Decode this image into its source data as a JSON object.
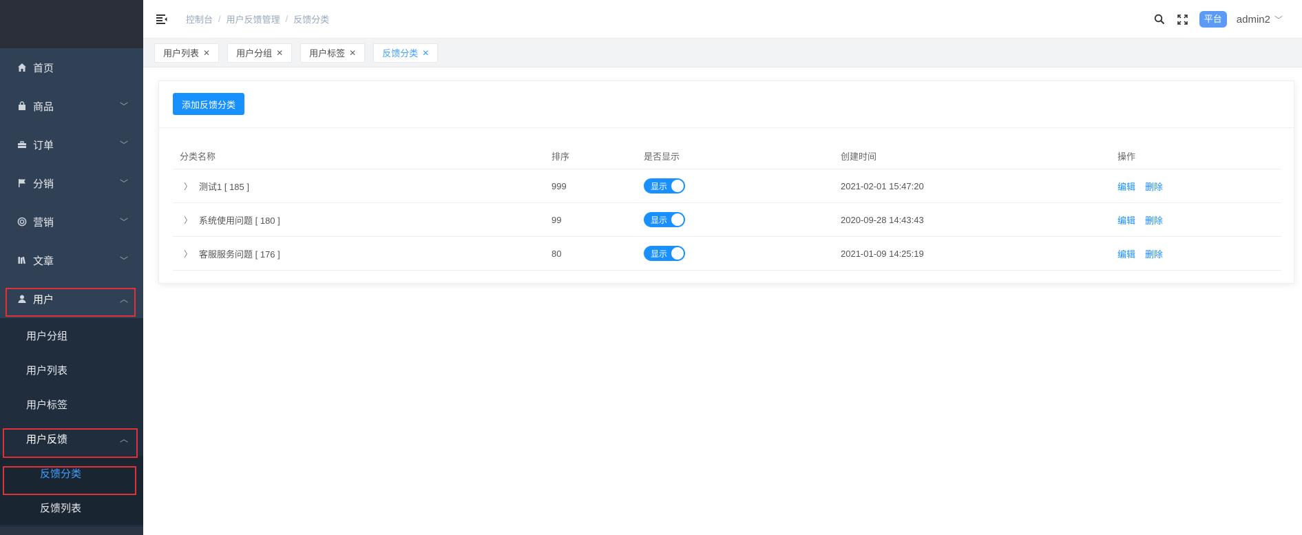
{
  "sidebar": {
    "menu": [
      {
        "label": "首页",
        "icon": "home-icon"
      },
      {
        "label": "商品",
        "icon": "bag-icon"
      },
      {
        "label": "订单",
        "icon": "briefcase-icon"
      },
      {
        "label": "分销",
        "icon": "flag-icon"
      },
      {
        "label": "营销",
        "icon": "ring-icon"
      },
      {
        "label": "文章",
        "icon": "books-icon"
      },
      {
        "label": "用户",
        "icon": "user-icon"
      }
    ],
    "user_submenu": [
      "用户分组",
      "用户列表",
      "用户标签",
      "用户反馈"
    ],
    "feedback_submenu": [
      "反馈分类",
      "反馈列表"
    ]
  },
  "header": {
    "breadcrumb": [
      "控制台",
      "用户反馈管理",
      "反馈分类"
    ],
    "platform_badge": "平台",
    "user_name": "admin2"
  },
  "tabs": [
    {
      "label": "用户列表",
      "active": false
    },
    {
      "label": "用户分组",
      "active": false
    },
    {
      "label": "用户标签",
      "active": false
    },
    {
      "label": "反馈分类",
      "active": true
    }
  ],
  "main": {
    "add_button": "添加反馈分类",
    "columns": [
      "分类名称",
      "排序",
      "是否显示",
      "创建时间",
      "操作"
    ],
    "rows": [
      {
        "name": "测试1 [ 185 ]",
        "sort": "999",
        "show": "显示",
        "created": "2021-02-01 15:47:20",
        "edit": "编辑",
        "delete": "删除"
      },
      {
        "name": "系统使用问题 [ 180 ]",
        "sort": "99",
        "show": "显示",
        "created": "2020-09-28 14:43:43",
        "edit": "编辑",
        "delete": "删除"
      },
      {
        "name": "客服服务问题 [ 176 ]",
        "sort": "80",
        "show": "显示",
        "created": "2021-01-09 14:25:19",
        "edit": "编辑",
        "delete": "删除"
      }
    ]
  },
  "colors": {
    "sidebar_bg": "#1f2d3d",
    "menu_bg": "#304156",
    "accent": "#1890ff",
    "highlight": "#e0303a"
  }
}
